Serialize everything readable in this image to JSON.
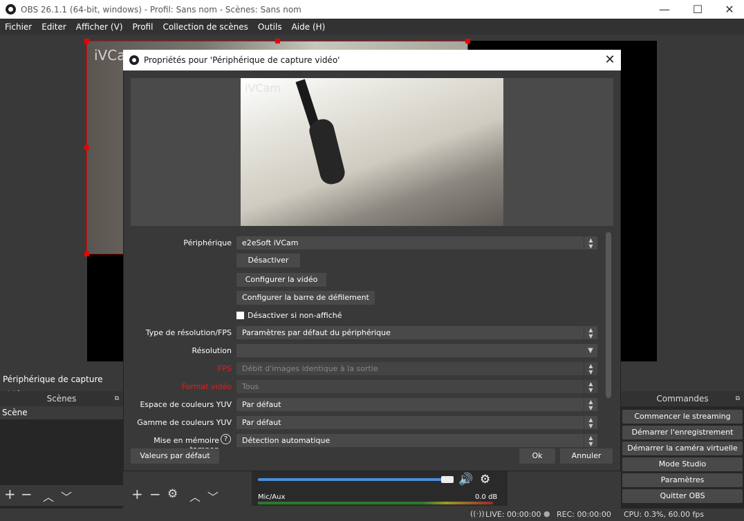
{
  "window": {
    "title": "OBS 26.1.1 (64-bit, windows) - Profil: Sans nom - Scènes: Sans nom"
  },
  "menu": [
    "Fichier",
    "Editer",
    "Afficher (V)",
    "Profil",
    "Collection de scènes",
    "Outils",
    "Aide (H)"
  ],
  "preview": {
    "overlay_text": "iVCam"
  },
  "source_label": "Périphérique de capture vidéo",
  "scenes": {
    "title": "Scènes",
    "items": [
      "Scène"
    ]
  },
  "mixer": {
    "channel": "Mic/Aux",
    "level": "0.0 dB",
    "volume_fraction": 0.95
  },
  "commands": {
    "title": "Commandes",
    "buttons": [
      "Commencer le streaming",
      "Démarrer l'enregistrement",
      "Démarrer la caméra virtuelle",
      "Mode Studio",
      "Paramètres",
      "Quitter OBS"
    ]
  },
  "status": {
    "live": "LIVE: 00:00:00",
    "rec": "REC: 00:00:00",
    "cpu": "CPU: 0.3%, 60.00 fps"
  },
  "dialog": {
    "title": "Propriétés pour 'Périphérique de capture vidéo'",
    "preview_text": "iVCam",
    "fields": {
      "device_label": "Périphérique",
      "device_value": "e2eSoft iVCam",
      "deactivate_btn": "Désactiver",
      "configure_video_btn": "Configurer la vidéo",
      "configure_crossbar_btn": "Configurer la barre de défilement",
      "deactivate_hidden_label": "Désactiver si non-affiché",
      "res_type_label": "Type de résolution/FPS",
      "res_type_value": "Paramètres par défaut du périphérique",
      "resolution_label": "Résolution",
      "resolution_value": "",
      "fps_label": "FPS",
      "fps_value": "Débit d'images identique à la sortie",
      "format_label": "Format vidéo",
      "format_value": "Tous",
      "yuv_space_label": "Espace de couleurs YUV",
      "yuv_space_value": "Par défaut",
      "yuv_range_label": "Gamme de couleurs YUV",
      "yuv_range_value": "Par défaut",
      "buffer_label": "Mise en mémoire tampon",
      "buffer_value": "Détection automatique"
    },
    "defaults_btn": "Valeurs par défaut",
    "ok_btn": "Ok",
    "cancel_btn": "Annuler"
  }
}
